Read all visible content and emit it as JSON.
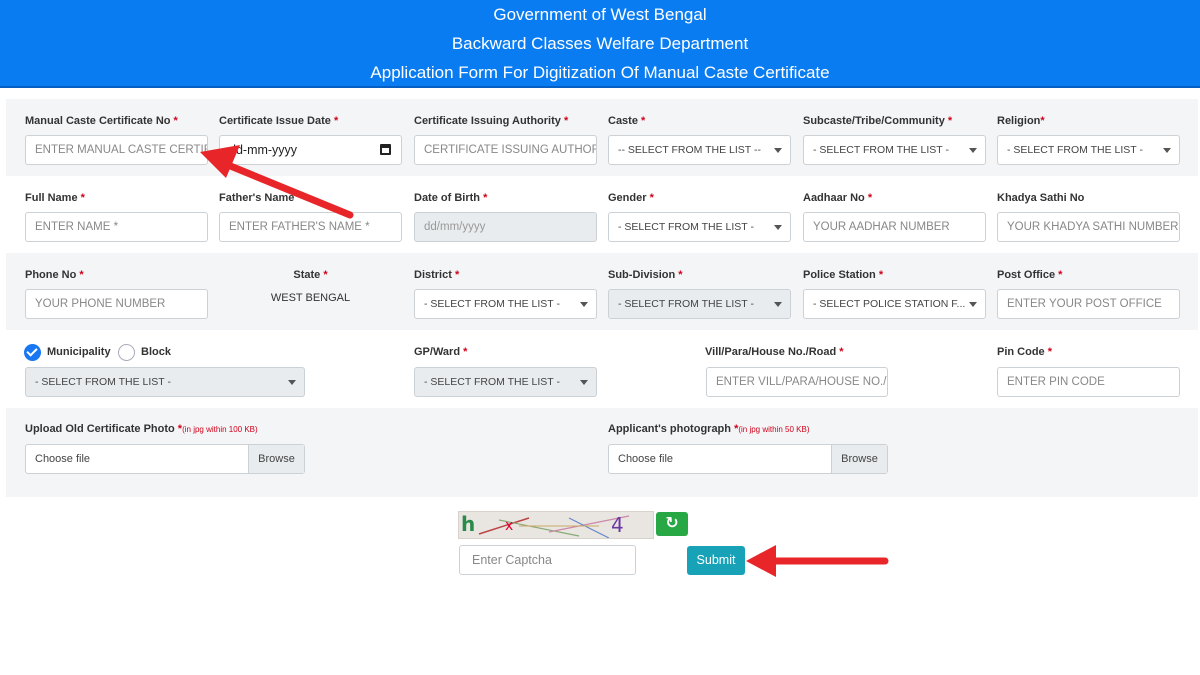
{
  "header": {
    "line1": "Government of West Bengal",
    "line2": "Backward Classes Welfare Department",
    "line3": "Application Form For Digitization Of Manual Caste Certificate"
  },
  "row1": {
    "certificate_no": {
      "label": "Manual Caste Certificate No",
      "required": "*",
      "placeholder": "ENTER MANUAL CASTE CERTIFI"
    },
    "issue_date": {
      "label": "Certificate Issue Date",
      "required": "*",
      "placeholder": "dd-mm-yyyy"
    },
    "authority": {
      "label": "Certificate Issuing Authority",
      "required": "*",
      "placeholder": "CERTIFICATE ISSUING AUTHOR"
    },
    "caste": {
      "label": "Caste",
      "required": "*",
      "value": "-- SELECT FROM THE LIST --"
    },
    "subcaste": {
      "label": "Subcaste/Tribe/Community",
      "required": "*",
      "value": "- SELECT FROM THE LIST -"
    },
    "religion": {
      "label": "Religion",
      "required": "*",
      "value": "- SELECT FROM THE LIST -"
    }
  },
  "row2": {
    "full_name": {
      "label": "Full Name",
      "required": "*",
      "placeholder": "ENTER NAME *"
    },
    "father_name": {
      "label": "Father's Name",
      "placeholder": "ENTER FATHER'S NAME *"
    },
    "dob": {
      "label": "Date of Birth",
      "required": "*",
      "placeholder": "dd/mm/yyyy"
    },
    "gender": {
      "label": "Gender",
      "required": "*",
      "value": "- SELECT FROM THE LIST -"
    },
    "aadhaar": {
      "label": "Aadhaar No",
      "required": "*",
      "placeholder": "YOUR AADHAR NUMBER"
    },
    "khadya": {
      "label": "Khadya Sathi No",
      "placeholder": "YOUR KHADYA SATHI NUMBER"
    }
  },
  "row3": {
    "phone": {
      "label": "Phone No",
      "required": "*",
      "placeholder": "YOUR PHONE NUMBER"
    },
    "state": {
      "label": "State",
      "required": "*",
      "value": "WEST BENGAL"
    },
    "district": {
      "label": "District",
      "required": "*",
      "value": "- SELECT FROM THE LIST -"
    },
    "subdivision": {
      "label": "Sub-Division",
      "required": "*",
      "value": "- SELECT FROM THE LIST -"
    },
    "police": {
      "label": "Police Station",
      "required": "*",
      "value": "- SELECT POLICE STATION F..."
    },
    "post": {
      "label": "Post Office",
      "required": "*",
      "placeholder": "ENTER YOUR POST OFFICE"
    }
  },
  "row4": {
    "municipality": "Municipality",
    "block": "Block",
    "area_select": "- SELECT FROM THE LIST -",
    "gp": {
      "label": "GP/Ward",
      "required": "*",
      "value": "- SELECT FROM THE LIST -"
    },
    "vill": {
      "label": "Vill/Para/House No./Road",
      "required": "*",
      "placeholder": "ENTER VILL/PARA/HOUSE NO./"
    },
    "pin": {
      "label": "Pin Code",
      "required": "*",
      "placeholder": "ENTER PIN CODE"
    }
  },
  "row5": {
    "old_photo": {
      "label": "Upload Old Certificate Photo",
      "required": "*",
      "note": "(in jpg within 100 KB)",
      "file": "Choose file",
      "browse": "Browse"
    },
    "applicant_photo": {
      "label": "Applicant's photograph",
      "required": "*",
      "note": "(in jpg within 50 KB)",
      "file": "Choose file",
      "browse": "Browse"
    }
  },
  "captcha": {
    "text": "h 4",
    "placeholder": "Enter Captcha",
    "refresh_icon": "refresh-icon",
    "submit": "Submit"
  },
  "colors": {
    "header": "#0a7cf1",
    "submit": "#17a2b8",
    "refresh": "#28a745",
    "arrow": "#e8262a"
  }
}
